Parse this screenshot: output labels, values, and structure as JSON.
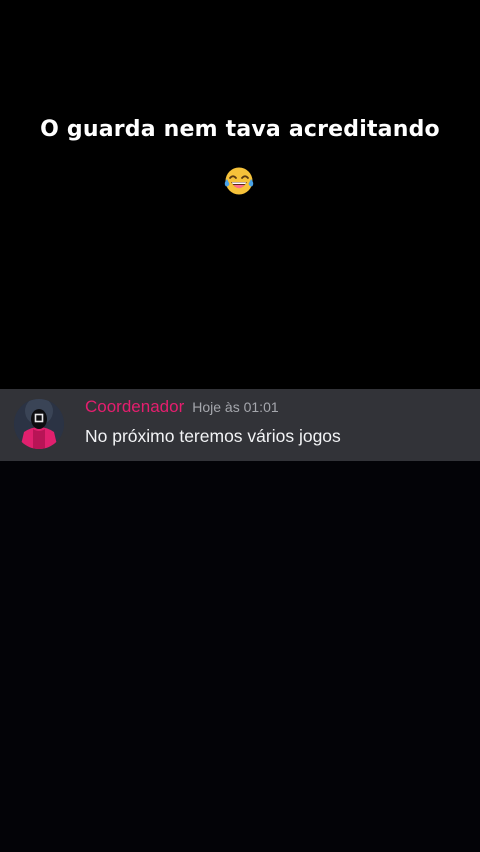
{
  "caption": {
    "text": "O guarda nem tava acreditando",
    "emoji_icon": "face-with-tears-of-joy-icon"
  },
  "message": {
    "username": "Coordenador",
    "timestamp": "Hoje às 01:01",
    "text": "No próximo teremos vários jogos",
    "avatar_icon": "masked-guard-avatar",
    "colors": {
      "username": "#e51e6e",
      "bar_background": "#323338",
      "text": "#f2f3f5",
      "timestamp": "#a5a7ad"
    }
  }
}
